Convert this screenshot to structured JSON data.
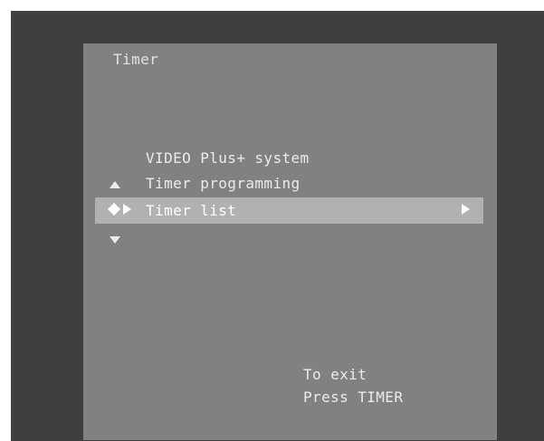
{
  "screen": {
    "title": "Timer"
  },
  "menu": {
    "items": [
      {
        "label": "VIDEO Plus+ system"
      },
      {
        "label": "Timer programming"
      },
      {
        "label": "Timer list",
        "selected": true
      }
    ]
  },
  "nav_icons": {
    "up": "triangle-up-icon",
    "down": "triangle-down-icon",
    "select": "diamond-icon",
    "pointer": "triangle-right-icon",
    "submenu": "triangle-right-icon"
  },
  "footer": {
    "exit_line_1": "To exit",
    "exit_line_2": "Press TIMER"
  },
  "colors": {
    "frame": "#3f3f3f",
    "screen": "#818181",
    "highlight": "#b1b1b1",
    "text": "#ebebeb"
  }
}
